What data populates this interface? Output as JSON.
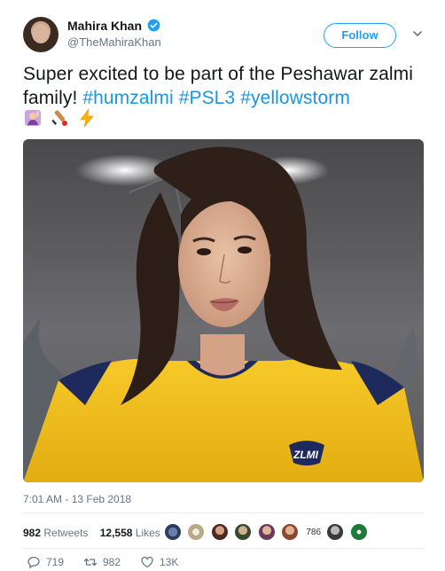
{
  "user": {
    "display_name": "Mahira Khan",
    "handle": "@TheMahiraKhan",
    "verified_icon": "verified-badge-icon"
  },
  "follow_button": {
    "label": "Follow"
  },
  "tweet": {
    "text_plain": "Super excited to be part of the Peshawar zalmi family! ",
    "hashtags": [
      "#humzalmi",
      "#PSL3",
      "#yellowstorm"
    ],
    "emojis": [
      "woman-raising-hand-emoji",
      "cricket-bat-emoji",
      "lightning-emoji"
    ]
  },
  "timestamp": "7:01 AM - 13 Feb 2018",
  "stats": {
    "retweets_count": "982",
    "retweets_label": "Retweets",
    "likes_count": "12,558",
    "likes_label": "Likes",
    "liker_badge": "786"
  },
  "actions": {
    "reply_count": "719",
    "retweet_count": "982",
    "like_count": "13K"
  },
  "colors": {
    "accent": "#1da1f2",
    "hashtag": "#1b95e0",
    "secondary_text": "#657786",
    "jersey_yellow": "#f2c21b"
  }
}
